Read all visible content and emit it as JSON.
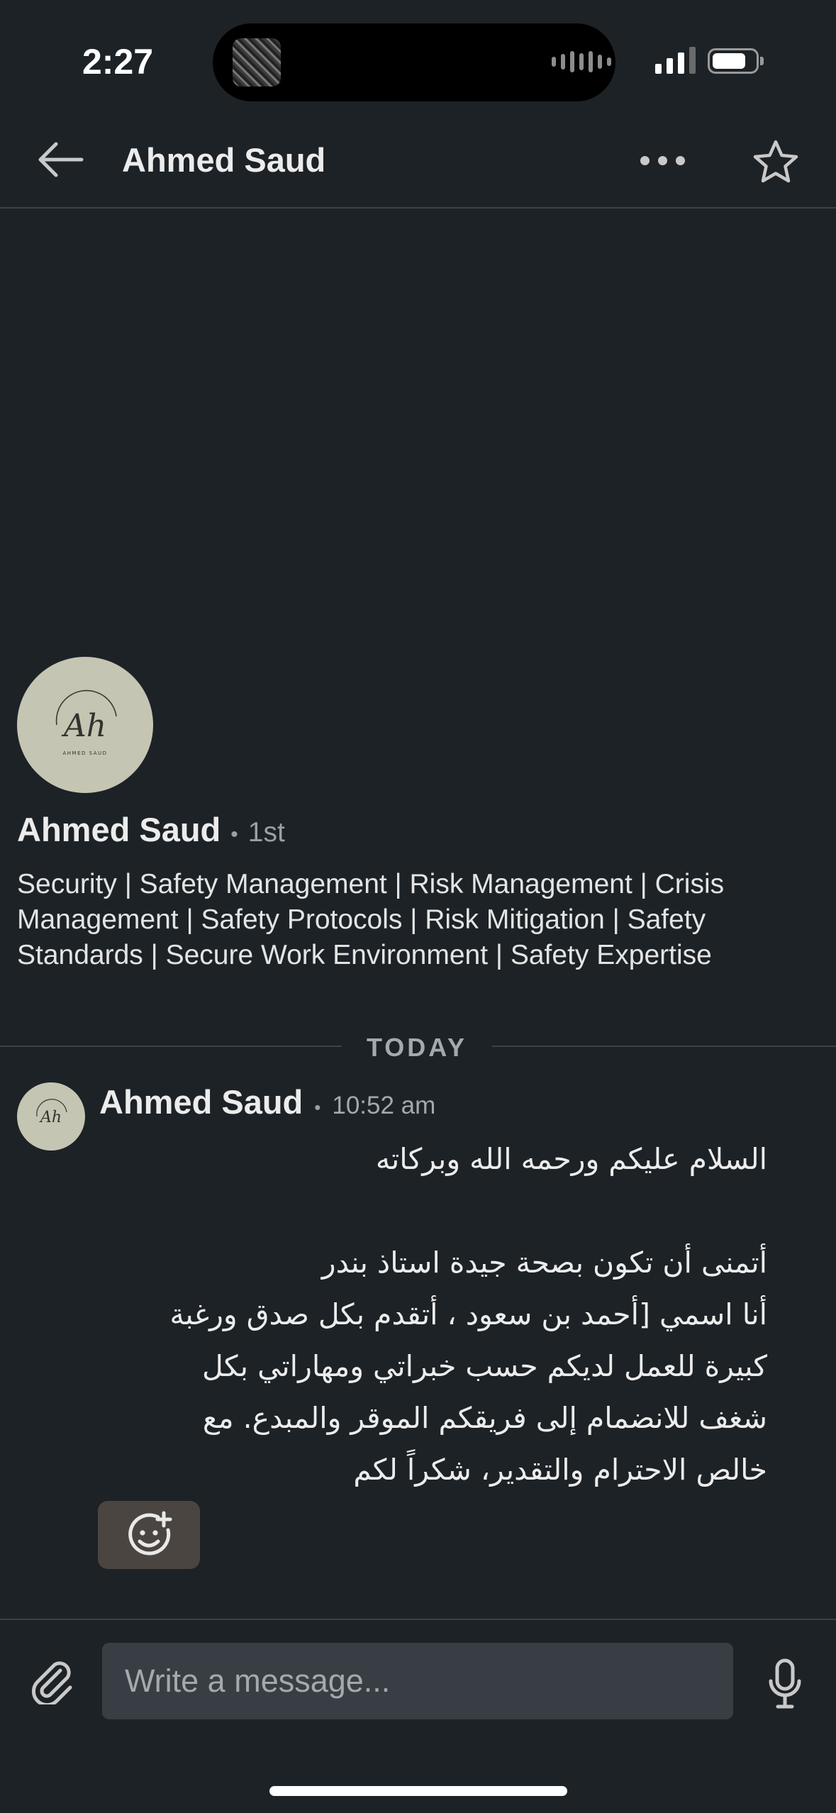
{
  "status_bar": {
    "time": "2:27"
  },
  "header": {
    "title": "Ahmed Saud",
    "icons": {
      "back": "arrow-left-icon",
      "more": "more-horizontal-icon",
      "star": "star-icon"
    }
  },
  "profile": {
    "name": "Ahmed Saud",
    "degree": "1st",
    "headline": "Security | Safety Management | Risk Management | Crisis Management | Safety Protocols | Risk Mitigation | Safety Standards | Secure Work Environment | Safety Expertise",
    "avatar_initials": "Ah",
    "avatar_subtext": "AHMED SAUD"
  },
  "date_divider": "TODAY",
  "message": {
    "sender": "Ahmed Saud",
    "time": "10:52 am",
    "body": "السلام عليكم ورحمه الله وبركاته\n\nأتمنى أن تكون بصحة جيدة استاذ بندر\nأنا اسمي [أحمد بن  سعود ، أتقدم بكل صدق ورغبة\nكبيرة للعمل لديكم حسب خبراتي ومهاراتي بكل\nشغف للانضمام إلى فريقكم الموقر والمبدع. مع\nخالص الاحترام والتقدير، شكراً لكم",
    "reaction_icon": "add-reaction-icon"
  },
  "composer": {
    "placeholder": "Write a message...",
    "attach_icon": "paperclip-icon",
    "mic_icon": "microphone-icon"
  },
  "colors": {
    "background": "#1d2226",
    "input_background": "#383e43",
    "reaction_background": "#4a4540",
    "avatar": "#c5c5b3"
  }
}
